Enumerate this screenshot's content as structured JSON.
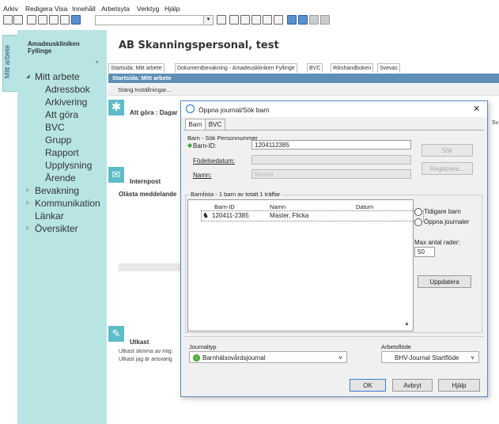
{
  "menu": [
    "Arkiv",
    "Redigera",
    "Visa",
    "Innehåll",
    "Arbetsyta",
    "Verktyg",
    "Hjälp"
  ],
  "sidebar": {
    "vertical_tab": "Mitt arbete",
    "clinic": "Amadeuskliniken Fyllinge",
    "collapse_glyph": "«",
    "items": [
      {
        "label": "Mitt arbete",
        "level": 1,
        "expanded": true
      },
      {
        "label": "Adressbok",
        "level": 2
      },
      {
        "label": "Arkivering",
        "level": 2
      },
      {
        "label": "Att göra",
        "level": 2
      },
      {
        "label": "BVC",
        "level": 2
      },
      {
        "label": "Grupp",
        "level": 2
      },
      {
        "label": "Rapport",
        "level": 2
      },
      {
        "label": "Upplysning",
        "level": 2
      },
      {
        "label": "Ärende",
        "level": 2
      },
      {
        "label": "Bevakning",
        "level": 1,
        "expanded": false
      },
      {
        "label": "Kommunikation",
        "level": 1,
        "expanded": false
      },
      {
        "label": "Länkar",
        "level": 1
      },
      {
        "label": "Översikter",
        "level": 1,
        "expanded": false
      }
    ]
  },
  "main": {
    "title": "AB Skanningspersonal, test",
    "tabs": [
      "Startsida: Mitt arbete",
      "Dokumentbevakning - Amadeuskliniken Fyllinge",
      "BVC",
      "Rikshandboken",
      "Svevac"
    ],
    "subheader": "Startsida: Mitt arbete",
    "commands": [
      "Stäng",
      "Inställningar..."
    ],
    "sections": {
      "todo_title": "Att göra : Dagar",
      "right_partial": "Sv",
      "mail_title": "Internpost",
      "mail_sub": "Olästa meddelande",
      "draft_title": "Utkast",
      "draft_line1": "Utkast skrivna av mig:",
      "draft_line2": "Utkast jag är ansvarig"
    }
  },
  "dialog": {
    "title": "Öppna journal/Sök barn",
    "close": "✕",
    "tabs": [
      "Barn",
      "BVC"
    ],
    "search_group": "Barn - Sök Personnummer",
    "barn_id_label": "Barn-ID:",
    "barn_id_value": "1204112385",
    "birthdate_label": "Födelsedatum:",
    "name_label": "Namn:",
    "name_placeholder": "Master",
    "search_button": "Sök",
    "register_button": "Registrera...",
    "list_group": "Barnlista - 1 barn av totalt 1 träffar",
    "columns": [
      "Barn-ID",
      "Namn",
      "Datum"
    ],
    "rows": [
      {
        "id": "120411-2385",
        "name": "Master, Flicka",
        "date": ""
      }
    ],
    "radio_previous": "Tidigare barn",
    "radio_open": "Öppna journaler",
    "max_rows_label": "Max antal rader:",
    "max_rows_value": "50",
    "update_button": "Uppdatera",
    "journal_type_label": "Journaltyp",
    "journal_type_value": "Barnhälsovårdsjournal",
    "workflow_label": "Arbetsflöde",
    "workflow_value": "BHV-Journal Startflöde",
    "ok_button": "OK",
    "cancel_button": "Avbryt",
    "help_button": "Hjälp"
  }
}
